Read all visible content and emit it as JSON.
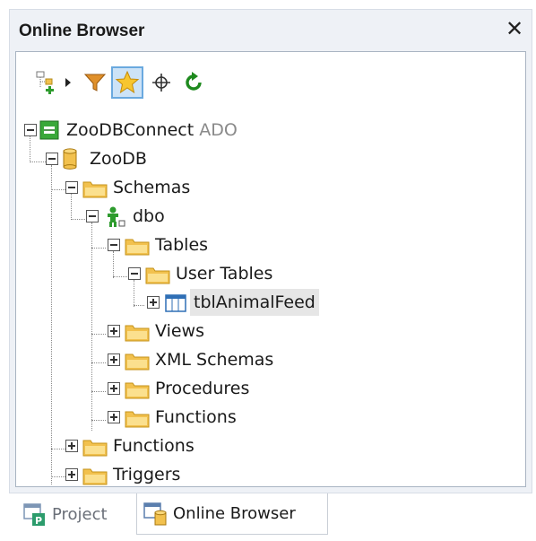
{
  "window": {
    "title": "Online Browser",
    "close_glyph": "✕"
  },
  "toolbar": {
    "buttons": [
      {
        "icon": "add-connection-icon"
      },
      {
        "icon": "dropdown-arrow-icon"
      },
      {
        "icon": "filter-icon"
      },
      {
        "icon": "favorites-star-icon",
        "active": true
      },
      {
        "icon": "crosshair-locate-icon"
      },
      {
        "icon": "refresh-icon"
      }
    ]
  },
  "tree": {
    "connection": {
      "label": "ZooDBConnect",
      "suffix": "ADO"
    },
    "database": {
      "label": "ZooDB"
    },
    "schemas": {
      "label": "Schemas"
    },
    "schema_dbo": {
      "label": "dbo"
    },
    "tables": {
      "label": "Tables"
    },
    "user_tables": {
      "label": "User Tables"
    },
    "table_animal_feed": {
      "label": "tblAnimalFeed"
    },
    "views": {
      "label": "Views"
    },
    "xml_schemas": {
      "label": "XML Schemas"
    },
    "procedures": {
      "label": "Procedures"
    },
    "functions_dbo": {
      "label": "Functions"
    },
    "functions_db": {
      "label": "Functions"
    },
    "triggers": {
      "label": "Triggers"
    }
  },
  "tabs": [
    {
      "label": "Project",
      "active": false
    },
    {
      "label": "Online Browser",
      "active": true
    }
  ],
  "colors": {
    "folder": "#f2c14e",
    "accent": "#6aa9df",
    "green": "#2e9b2e"
  }
}
